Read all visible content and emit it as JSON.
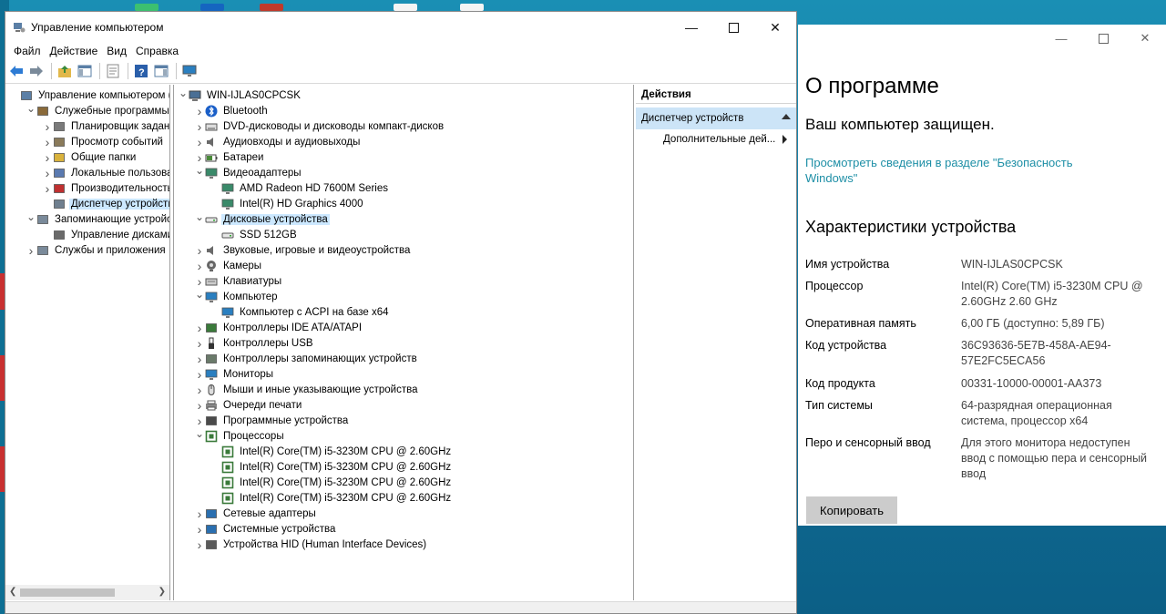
{
  "window": {
    "title": "Управление компьютером"
  },
  "menu": [
    "Файл",
    "Действие",
    "Вид",
    "Справка"
  ],
  "left_tree": [
    {
      "label": "Управление компьютером (л",
      "level": 0,
      "exp": "",
      "icon": "computer-management-icon",
      "color": "#5b7fa6"
    },
    {
      "label": "Служебные программы",
      "level": 1,
      "exp": "open",
      "icon": "tools-icon",
      "color": "#8a6a3a"
    },
    {
      "label": "Планировщик заданий",
      "level": 2,
      "exp": "closed",
      "icon": "clock-icon",
      "color": "#7a7a7a"
    },
    {
      "label": "Просмотр событий",
      "level": 2,
      "exp": "closed",
      "icon": "event-viewer-icon",
      "color": "#8a7a5a"
    },
    {
      "label": "Общие папки",
      "level": 2,
      "exp": "closed",
      "icon": "shared-folder-icon",
      "color": "#d9b23c"
    },
    {
      "label": "Локальные пользовате",
      "level": 2,
      "exp": "closed",
      "icon": "users-icon",
      "color": "#5a7ab0"
    },
    {
      "label": "Производительность",
      "level": 2,
      "exp": "closed",
      "icon": "performance-icon",
      "color": "#c03030"
    },
    {
      "label": "Диспетчер устройств",
      "level": 2,
      "exp": "",
      "icon": "device-manager-icon",
      "color": "#6f7f8f",
      "selected": true
    },
    {
      "label": "Запоминающие устройст",
      "level": 1,
      "exp": "open",
      "icon": "storage-icon",
      "color": "#7a8a9a"
    },
    {
      "label": "Управление дисками",
      "level": 2,
      "exp": "",
      "icon": "disk-management-icon",
      "color": "#6a6a6a"
    },
    {
      "label": "Службы и приложения",
      "level": 1,
      "exp": "closed",
      "icon": "services-icon",
      "color": "#7a8a9a"
    }
  ],
  "device_tree": [
    {
      "label": "WIN-IJLAS0CPCSK",
      "level": 0,
      "exp": "open",
      "icon": "computer-icon",
      "color": "#4a6f95"
    },
    {
      "label": "Bluetooth",
      "level": 1,
      "exp": "closed",
      "icon": "bluetooth-icon",
      "color": "#1a5fc8"
    },
    {
      "label": "DVD-дисководы и дисководы компакт-дисков",
      "level": 1,
      "exp": "closed",
      "icon": "dvd-drive-icon",
      "color": "#6a6a6a"
    },
    {
      "label": "Аудиовходы и аудиовыходы",
      "level": 1,
      "exp": "closed",
      "icon": "speaker-icon",
      "color": "#6a6a6a"
    },
    {
      "label": "Батареи",
      "level": 1,
      "exp": "closed",
      "icon": "battery-icon",
      "color": "#4a8a3a"
    },
    {
      "label": "Видеоадаптеры",
      "level": 1,
      "exp": "open",
      "icon": "display-adapter-icon",
      "color": "#3a8a6a"
    },
    {
      "label": "AMD Radeon HD 7600M Series",
      "level": 2,
      "exp": "",
      "icon": "display-adapter-icon",
      "color": "#3a8a6a"
    },
    {
      "label": "Intel(R) HD Graphics 4000",
      "level": 2,
      "exp": "",
      "icon": "display-adapter-icon",
      "color": "#3a8a6a"
    },
    {
      "label": "Дисковые устройства",
      "level": 1,
      "exp": "open",
      "icon": "disk-drive-icon",
      "color": "#5a5a5a",
      "selected": true
    },
    {
      "label": "SSD 512GB",
      "level": 2,
      "exp": "",
      "icon": "disk-drive-icon",
      "color": "#5a5a5a"
    },
    {
      "label": "Звуковые, игровые и видеоустройства",
      "level": 1,
      "exp": "closed",
      "icon": "sound-icon",
      "color": "#6a6a6a"
    },
    {
      "label": "Камеры",
      "level": 1,
      "exp": "closed",
      "icon": "camera-icon",
      "color": "#4a4a4a"
    },
    {
      "label": "Клавиатуры",
      "level": 1,
      "exp": "closed",
      "icon": "keyboard-icon",
      "color": "#7a7a7a"
    },
    {
      "label": "Компьютер",
      "level": 1,
      "exp": "open",
      "icon": "monitor-icon",
      "color": "#2a7fc0"
    },
    {
      "label": "Компьютер с ACPI на базе x64",
      "level": 2,
      "exp": "",
      "icon": "monitor-icon",
      "color": "#2a7fc0"
    },
    {
      "label": "Контроллеры IDE ATA/ATAPI",
      "level": 1,
      "exp": "closed",
      "icon": "ide-controller-icon",
      "color": "#3a7a3a"
    },
    {
      "label": "Контроллеры USB",
      "level": 1,
      "exp": "closed",
      "icon": "usb-icon",
      "color": "#4a4a4a"
    },
    {
      "label": "Контроллеры запоминающих устройств",
      "level": 1,
      "exp": "closed",
      "icon": "storage-controller-icon",
      "color": "#6a7a6a"
    },
    {
      "label": "Мониторы",
      "level": 1,
      "exp": "closed",
      "icon": "monitor-icon",
      "color": "#2a7fc0"
    },
    {
      "label": "Мыши и иные указывающие устройства",
      "level": 1,
      "exp": "closed",
      "icon": "mouse-icon",
      "color": "#6a6a6a"
    },
    {
      "label": "Очереди печати",
      "level": 1,
      "exp": "closed",
      "icon": "printer-icon",
      "color": "#5a5a5a"
    },
    {
      "label": "Программные устройства",
      "level": 1,
      "exp": "closed",
      "icon": "software-device-icon",
      "color": "#4a4a4a"
    },
    {
      "label": "Процессоры",
      "level": 1,
      "exp": "open",
      "icon": "processor-icon",
      "color": "#3a7a3a"
    },
    {
      "label": "Intel(R) Core(TM) i5-3230M CPU @ 2.60GHz",
      "level": 2,
      "exp": "",
      "icon": "processor-icon",
      "color": "#3a7a3a"
    },
    {
      "label": "Intel(R) Core(TM) i5-3230M CPU @ 2.60GHz",
      "level": 2,
      "exp": "",
      "icon": "processor-icon",
      "color": "#3a7a3a"
    },
    {
      "label": "Intel(R) Core(TM) i5-3230M CPU @ 2.60GHz",
      "level": 2,
      "exp": "",
      "icon": "processor-icon",
      "color": "#3a7a3a"
    },
    {
      "label": "Intel(R) Core(TM) i5-3230M CPU @ 2.60GHz",
      "level": 2,
      "exp": "",
      "icon": "processor-icon",
      "color": "#3a7a3a"
    },
    {
      "label": "Сетевые адаптеры",
      "level": 1,
      "exp": "closed",
      "icon": "network-adapter-icon",
      "color": "#2a6fb0"
    },
    {
      "label": "Системные устройства",
      "level": 1,
      "exp": "closed",
      "icon": "system-device-icon",
      "color": "#2a6fb0"
    },
    {
      "label": "Устройства HID (Human Interface Devices)",
      "level": 1,
      "exp": "closed",
      "icon": "hid-icon",
      "color": "#5a5a5a"
    }
  ],
  "actions": {
    "header": "Действия",
    "selected": "Диспетчер устройств",
    "more": "Дополнительные дей..."
  },
  "about": {
    "title": "О программе",
    "protected": "Ваш компьютер защищен.",
    "link": "Просмотреть сведения в разделе \"Безопасность Windows\"",
    "specs_title": "Характеристики устройства",
    "specs": [
      {
        "key": "Имя устройства",
        "value": "WIN-IJLAS0CPCSK"
      },
      {
        "key": "Процессор",
        "value": "Intel(R) Core(TM) i5-3230M CPU @ 2.60GHz   2.60 GHz"
      },
      {
        "key": "Оперативная память",
        "value": "6,00 ГБ (доступно: 5,89 ГБ)"
      },
      {
        "key": "Код устройства",
        "value": "36C93636-5E7B-458A-AE94-57E2FC5ECA56"
      },
      {
        "key": "Код продукта",
        "value": "00331-10000-00001-AA373"
      },
      {
        "key": "Тип системы",
        "value": "64-разрядная операционная система, процессор x64"
      },
      {
        "key": "Перо и сенсорный ввод",
        "value": "Для этого монитора недоступен ввод с помощью пера и сенсорный ввод"
      }
    ],
    "copy_label": "Копировать"
  },
  "colors": {
    "selection": "#cce8ff",
    "link": "#1e8fa6",
    "accent": "#cce4f7"
  }
}
